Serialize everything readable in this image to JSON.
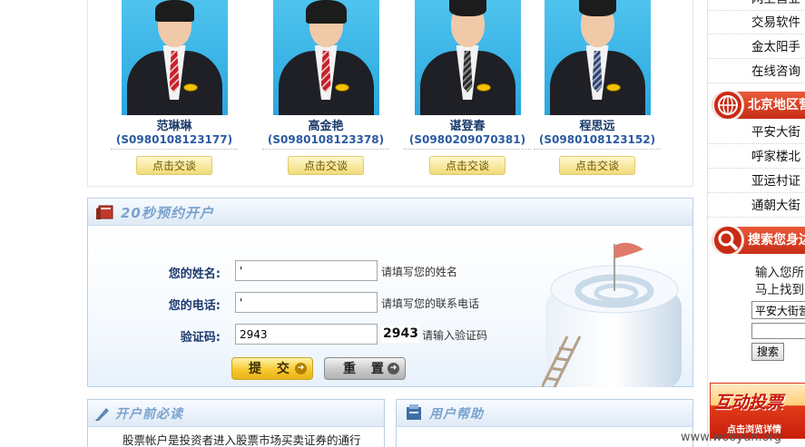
{
  "advisors": [
    {
      "name": "范琳琳",
      "code": "(S0980108123177)",
      "chat_label": "点击交谈"
    },
    {
      "name": "高金艳",
      "code": "(S0980108123378)",
      "chat_label": "点击交谈"
    },
    {
      "name": "谌登春",
      "code": "(S0980209070381)",
      "chat_label": "点击交谈"
    },
    {
      "name": "程思远",
      "code": "(S0980108123152)",
      "chat_label": "点击交谈"
    }
  ],
  "open_account": {
    "title": "20秒预约开户",
    "name_label": "您的姓名:",
    "name_value": "'",
    "name_hint": "请填写您的姓名",
    "phone_label": "您的电话:",
    "phone_value": "'",
    "phone_hint": "请填写您的联系电话",
    "captcha_label": "验证码:",
    "captcha_value": "2943",
    "captcha_image_text": "2943",
    "captcha_hint": "请输入验证码",
    "submit_label": "提 交",
    "reset_label": "重 置"
  },
  "bottom": {
    "left_title": "开户前必读",
    "left_text": "股票帐户是投资者进入股票市场买卖证券的通行",
    "right_title": "用户帮助"
  },
  "sidebar": {
    "top_links": [
      "网上营业",
      "交易软件",
      "金太阳手",
      "在线咨询"
    ],
    "region_header": "北京地区营",
    "region_links": [
      "平安大街",
      "呼家楼北",
      "亚运村证",
      "通朝大街"
    ],
    "search_header": "搜索您身边",
    "search_text_1": "输入您所",
    "search_text_2": "马上找到",
    "select_value": "平安大街营",
    "search_button": "搜索",
    "promo_big": "互动投票",
    "promo_small": "点击浏览详情"
  },
  "watermark": "www.wooyun.org",
  "colors": {
    "accent_blue": "#1c3b6d",
    "sidebar_red": "#c72d16",
    "panel_border": "#b9cfe6"
  }
}
